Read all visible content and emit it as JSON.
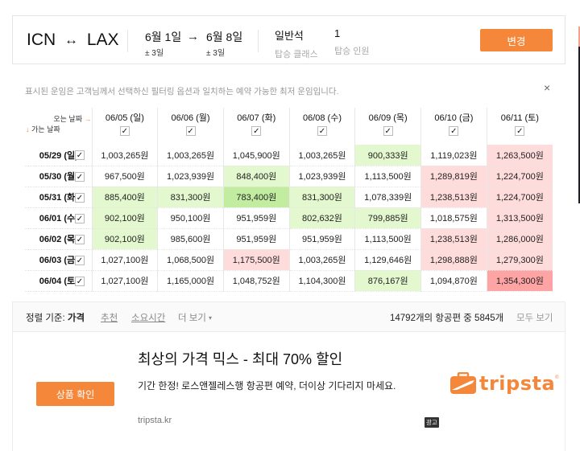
{
  "summary": {
    "origin": "ICN",
    "route_arrow": "↔",
    "destination": "LAX",
    "depart_date": "6월 1일",
    "depart_flex": "± 3일",
    "date_arrow": "→",
    "return_date": "6월 8일",
    "return_flex": "± 3일",
    "cabin_value": "일반석",
    "cabin_label": "탑승 클래스",
    "passengers_value": "1",
    "passengers_label": "탑승 인원",
    "change_button": "변경"
  },
  "grid": {
    "notice": "표시된 운임은 고객님께서 선택하신 필터링 옵션과 일치하는 예약 가능한 최저 운임입니다.",
    "close_icon": "×",
    "return_label": "오는 날짜",
    "return_arrow": "→",
    "depart_label": "가는 날짜",
    "depart_arrow": "↓",
    "check_glyph": "✓",
    "columns": [
      "06/05 (일)",
      "06/06 (월)",
      "06/07 (화)",
      "06/08 (수)",
      "06/09 (목)",
      "06/10 (금)",
      "06/11 (토)"
    ],
    "colors": {
      "white": "#ffffff",
      "lgreen": "#e4f8cf",
      "green": "#c2eda1",
      "lred": "#ffdcdc",
      "red": "#ffa4a4"
    },
    "rows": [
      {
        "date": "05/29 (일)",
        "checked": true,
        "prices": [
          "1,003,265원",
          "1,003,265원",
          "1,045,900원",
          "1,003,265원",
          "900,333원",
          "1,119,023원",
          "1,263,500원"
        ],
        "levels": [
          "white",
          "white",
          "white",
          "white",
          "lgreen",
          "white",
          "lred"
        ]
      },
      {
        "date": "05/30 (월)",
        "checked": true,
        "prices": [
          "967,500원",
          "1,023,939원",
          "848,400원",
          "1,023,939원",
          "1,113,500원",
          "1,289,819원",
          "1,224,700원"
        ],
        "levels": [
          "white",
          "white",
          "lgreen",
          "white",
          "white",
          "lred",
          "lred"
        ]
      },
      {
        "date": "05/31 (화)",
        "checked": true,
        "prices": [
          "885,400원",
          "831,300원",
          "783,400원",
          "831,300원",
          "1,078,339원",
          "1,238,513원",
          "1,224,700원"
        ],
        "levels": [
          "lgreen",
          "lgreen",
          "green",
          "lgreen",
          "white",
          "lred",
          "lred"
        ]
      },
      {
        "date": "06/01 (수)",
        "checked": true,
        "prices": [
          "902,100원",
          "950,100원",
          "951,959원",
          "802,632원",
          "799,885원",
          "1,018,575원",
          "1,313,500원"
        ],
        "levels": [
          "lgreen",
          "white",
          "white",
          "lgreen",
          "lgreen",
          "white",
          "lred"
        ]
      },
      {
        "date": "06/02 (목)",
        "checked": true,
        "prices": [
          "902,100원",
          "985,600원",
          "951,959원",
          "951,959원",
          "1,113,500원",
          "1,238,513원",
          "1,286,000원"
        ],
        "levels": [
          "lgreen",
          "white",
          "white",
          "white",
          "white",
          "lred",
          "lred"
        ]
      },
      {
        "date": "06/03 (금)",
        "checked": true,
        "prices": [
          "1,027,100원",
          "1,068,500원",
          "1,175,500원",
          "1,003,265원",
          "1,129,646원",
          "1,298,888원",
          "1,279,300원"
        ],
        "levels": [
          "white",
          "white",
          "lred",
          "white",
          "white",
          "lred",
          "lred"
        ]
      },
      {
        "date": "06/04 (토)",
        "checked": true,
        "prices": [
          "1,027,100원",
          "1,165,000원",
          "1,048,752원",
          "1,104,300원",
          "876,167원",
          "1,094,870원",
          "1,354,300원"
        ],
        "levels": [
          "white",
          "white",
          "white",
          "white",
          "lgreen",
          "white",
          "red"
        ]
      }
    ]
  },
  "sortbar": {
    "label": "정렬 기준:",
    "active": "가격",
    "options": [
      "추천",
      "소요시간"
    ],
    "more": "더 보기",
    "more_caret": "▾",
    "count_text": "14792개의 항공편 중 5845개",
    "show_all": "모두 보기"
  },
  "ad": {
    "button": "상품 확인",
    "title": "최상의 가격 믹스 - 최대 70% 할인",
    "description": "기간 한정! 로스앤젤레스행 항공편 예약, 더이상 기다리지 마세요.",
    "url": "tripsta.kr",
    "brand": "tripsta",
    "brand_reg": "®",
    "brand_color": "#f5873a",
    "badge": "광고"
  }
}
